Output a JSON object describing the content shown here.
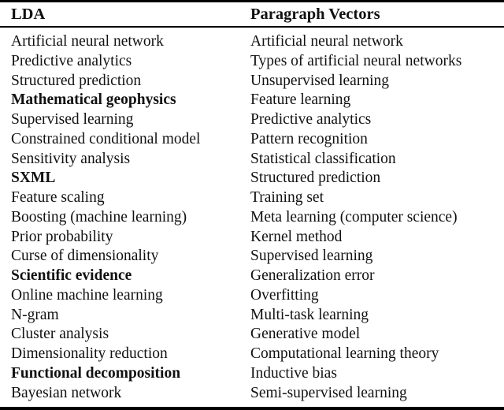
{
  "table": {
    "headers": [
      "LDA",
      "Paragraph Vectors"
    ],
    "columns": [
      {
        "name": "LDA",
        "items": [
          {
            "text": "Artificial neural network",
            "bold": false
          },
          {
            "text": "Predictive analytics",
            "bold": false
          },
          {
            "text": "Structured prediction",
            "bold": false
          },
          {
            "text": "Mathematical geophysics",
            "bold": true
          },
          {
            "text": "Supervised learning",
            "bold": false
          },
          {
            "text": "Constrained conditional model",
            "bold": false
          },
          {
            "text": "Sensitivity analysis",
            "bold": false
          },
          {
            "text": "SXML",
            "bold": true
          },
          {
            "text": "Feature scaling",
            "bold": false
          },
          {
            "text": "Boosting (machine learning)",
            "bold": false
          },
          {
            "text": "Prior probability",
            "bold": false
          },
          {
            "text": "Curse of dimensionality",
            "bold": false
          },
          {
            "text": "Scientific evidence",
            "bold": true
          },
          {
            "text": "Online machine learning",
            "bold": false
          },
          {
            "text": "N-gram",
            "bold": false
          },
          {
            "text": "Cluster analysis",
            "bold": false
          },
          {
            "text": "Dimensionality reduction",
            "bold": false
          },
          {
            "text": "Functional decomposition",
            "bold": true
          },
          {
            "text": "Bayesian network",
            "bold": false
          }
        ]
      },
      {
        "name": "Paragraph Vectors",
        "items": [
          {
            "text": "Artificial neural network",
            "bold": false
          },
          {
            "text": "Types of artificial neural networks",
            "bold": false
          },
          {
            "text": "Unsupervised learning",
            "bold": false
          },
          {
            "text": "Feature learning",
            "bold": false
          },
          {
            "text": "Predictive analytics",
            "bold": false
          },
          {
            "text": "Pattern recognition",
            "bold": false
          },
          {
            "text": "Statistical classification",
            "bold": false
          },
          {
            "text": "Structured prediction",
            "bold": false
          },
          {
            "text": "Training set",
            "bold": false
          },
          {
            "text": "Meta learning (computer science)",
            "bold": false
          },
          {
            "text": "Kernel method",
            "bold": false
          },
          {
            "text": "Supervised learning",
            "bold": false
          },
          {
            "text": "Generalization error",
            "bold": false
          },
          {
            "text": "Overfitting",
            "bold": false
          },
          {
            "text": "Multi-task learning",
            "bold": false
          },
          {
            "text": "Generative model",
            "bold": false
          },
          {
            "text": "Computational learning theory",
            "bold": false
          },
          {
            "text": "Inductive bias",
            "bold": false
          },
          {
            "text": "Semi-supervised learning",
            "bold": false
          }
        ]
      }
    ]
  }
}
